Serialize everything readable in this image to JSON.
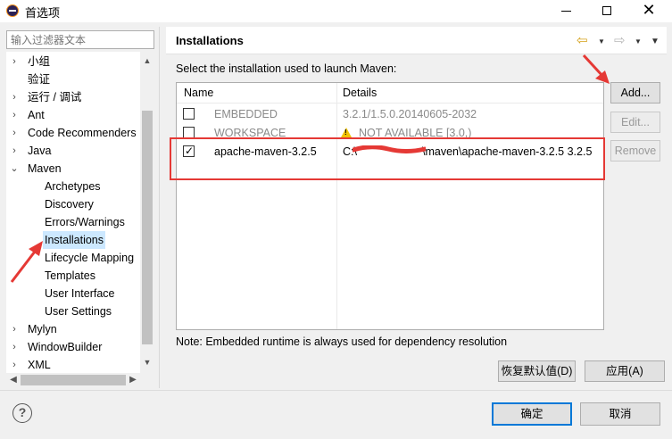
{
  "window": {
    "title": "首选项",
    "controls": {
      "minimize_icon": "minimize-icon",
      "maximize_icon": "maximize-icon",
      "close_icon": "close-icon"
    }
  },
  "filter": {
    "placeholder": "输入过滤器文本"
  },
  "tree": {
    "items": [
      {
        "label": "小组",
        "arrow": "›",
        "level": 0
      },
      {
        "label": "验证",
        "arrow": "",
        "level": 0
      },
      {
        "label": "运行 / 调试",
        "arrow": "›",
        "level": 0
      },
      {
        "label": "Ant",
        "arrow": "›",
        "level": 0
      },
      {
        "label": "Code Recommenders",
        "arrow": "›",
        "level": 0
      },
      {
        "label": "Java",
        "arrow": "›",
        "level": 0
      },
      {
        "label": "Maven",
        "arrow": "⌄",
        "level": 0
      },
      {
        "label": "Archetypes",
        "arrow": "",
        "level": 1
      },
      {
        "label": "Discovery",
        "arrow": "",
        "level": 1
      },
      {
        "label": "Errors/Warnings",
        "arrow": "",
        "level": 1
      },
      {
        "label": "Installations",
        "arrow": "",
        "level": 1,
        "selected": true
      },
      {
        "label": "Lifecycle Mapping",
        "arrow": "",
        "level": 1
      },
      {
        "label": "Templates",
        "arrow": "",
        "level": 1
      },
      {
        "label": "User Interface",
        "arrow": "",
        "level": 1
      },
      {
        "label": "User Settings",
        "arrow": "",
        "level": 1
      },
      {
        "label": "Mylyn",
        "arrow": "›",
        "level": 0
      },
      {
        "label": "WindowBuilder",
        "arrow": "›",
        "level": 0
      },
      {
        "label": "XML",
        "arrow": "›",
        "level": 0
      }
    ]
  },
  "page": {
    "title": "Installations",
    "instructions": "Select the installation used to launch Maven:",
    "table": {
      "columns": [
        "Name",
        "Details"
      ],
      "rows": [
        {
          "checked": false,
          "name": "EMBEDDED",
          "details": "3.2.1/1.5.0.20140605-2032",
          "disabled": true,
          "warning": false
        },
        {
          "checked": false,
          "name": "WORKSPACE",
          "details": "NOT AVAILABLE [3.0,)",
          "disabled": true,
          "warning": true
        },
        {
          "checked": true,
          "name": "apache-maven-3.2.5",
          "details_prefix": "C:\\",
          "details": "\\maven\\apache-maven-3.2.5 3.2.5",
          "disabled": false,
          "warning": false
        }
      ]
    },
    "buttons": {
      "add": "Add...",
      "edit": "Edit...",
      "remove": "Remove"
    },
    "note": "Note: Embedded runtime is always used for dependency resolution",
    "restore_defaults": "恢复默认值(D)",
    "apply": "应用(A)"
  },
  "footer": {
    "ok": "确定",
    "cancel": "取消"
  },
  "colors": {
    "selection": "#cce8ff",
    "annotation_red": "#e53935",
    "default_button_border": "#0078d7"
  }
}
